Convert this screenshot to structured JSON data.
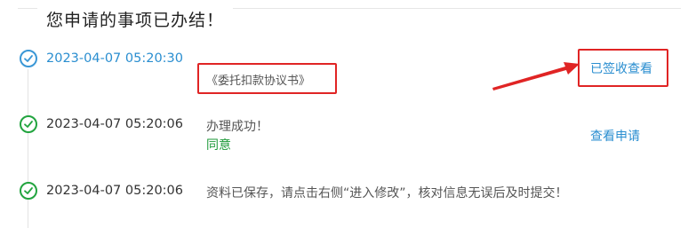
{
  "page": {
    "title": "您申请的事项已办结！"
  },
  "colors": {
    "accent_blue": "#2a8ed0",
    "success_green": "#22a43f",
    "highlight_red": "#e02424"
  },
  "entries": [
    {
      "status_icon": "clock-check-icon",
      "time": "2023-04-07 05:20:30",
      "document": "《委托扣款协议书》",
      "action": "已签收查看"
    },
    {
      "status_icon": "check-circle-icon",
      "time": "2023-04-07 05:20:06",
      "message": "办理成功！",
      "result": "同意",
      "action": "查看申请"
    },
    {
      "status_icon": "check-circle-icon",
      "time": "2023-04-07 05:20:06",
      "message": "资料已保存，请点击右侧“进入修改”，核对信息无误后及时提交！"
    }
  ]
}
